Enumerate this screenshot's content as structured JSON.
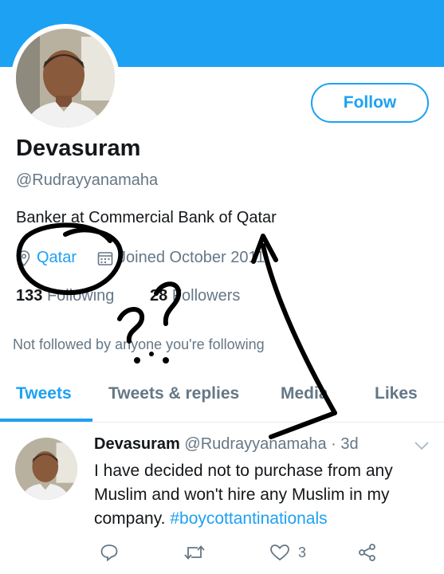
{
  "profile": {
    "name": "Devasuram",
    "handle": "@Rudrayyanamaha",
    "bio": "Banker at Commercial Bank of Qatar",
    "location": "Qatar",
    "joined": "Joined October 2011",
    "following_count": "133",
    "following_label": "Following",
    "followers_count": "28",
    "followers_label": "Followers",
    "not_followed_text": "Not followed by anyone you're following",
    "follow_button": "Follow"
  },
  "tabs": [
    {
      "label": "Tweets",
      "active": true
    },
    {
      "label": "Tweets & replies",
      "active": false
    },
    {
      "label": "Media",
      "active": false
    },
    {
      "label": "Likes",
      "active": false
    }
  ],
  "tweet": {
    "name": "Devasuram",
    "handle": "@Rudrayyanamaha",
    "separator": "·",
    "time": "3d",
    "body": "I have decided not to purchase from any Muslim and won't hire any Muslim in my company.",
    "hashtag": "#boycottantinationals",
    "likes": "3"
  },
  "icons": [
    "location-icon",
    "calendar-icon",
    "chevron-down-icon",
    "reply-icon",
    "retweet-icon",
    "like-icon",
    "share-icon"
  ],
  "colors": {
    "accent": "#1da1f2",
    "secondary_text": "#657786",
    "primary_text": "#14171a",
    "scribble": "#000000"
  }
}
